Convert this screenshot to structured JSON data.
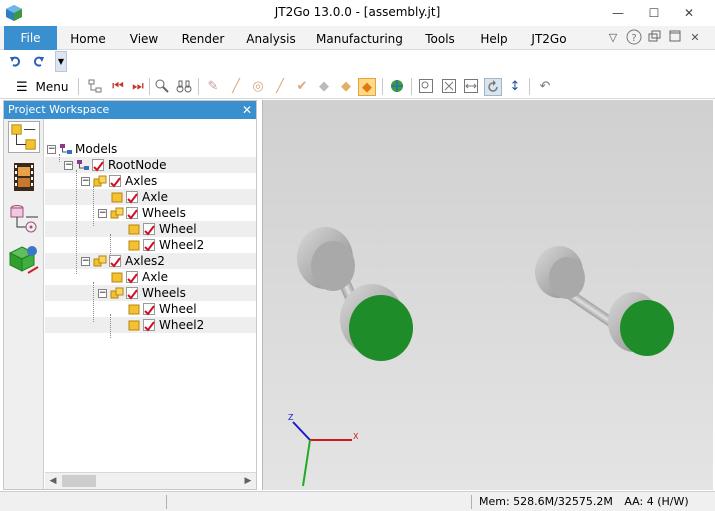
{
  "window": {
    "title": "JT2Go 13.0.0 - [assembly.jt]",
    "minimize_glyph": "—",
    "maximize_glyph": "☐",
    "close_glyph": "✕"
  },
  "menu": {
    "file_label": "File",
    "tabs": [
      "Home",
      "View",
      "Render",
      "Analysis",
      "Manufacturing",
      "Tools",
      "Help",
      "JT2Go"
    ],
    "right_icons": [
      "chevron-down-icon",
      "help-icon",
      "restore-icon",
      "maximize-icon",
      "close-icon"
    ]
  },
  "quick_access": {
    "undo_icon": "undo-icon",
    "redo_icon": "redo-icon"
  },
  "toolbar": {
    "menu_label": "Menu"
  },
  "workspace": {
    "title": "Project Workspace",
    "close_glyph": "✕",
    "side_tabs": [
      "model-tree-icon",
      "film-icon",
      "database-icon",
      "cube-network-icon"
    ]
  },
  "tree": {
    "rows": [
      {
        "label": "Models",
        "icon": "models-icon",
        "checked": false,
        "expander": "−"
      },
      {
        "label": "RootNode",
        "icon": "rootnode-icon",
        "checked": true,
        "expander": "−"
      },
      {
        "label": "Axles",
        "icon": "assembly-icon",
        "checked": true,
        "expander": "−"
      },
      {
        "label": "Axle",
        "icon": "part-icon",
        "checked": true,
        "expander": ""
      },
      {
        "label": "Wheels",
        "icon": "assembly-icon",
        "checked": true,
        "expander": "−"
      },
      {
        "label": "Wheel",
        "icon": "part-icon",
        "checked": true,
        "expander": ""
      },
      {
        "label": "Wheel2",
        "icon": "part-icon",
        "checked": true,
        "expander": ""
      },
      {
        "label": "Axles2",
        "icon": "assembly-icon",
        "checked": true,
        "expander": "−"
      },
      {
        "label": "Axle",
        "icon": "part-icon",
        "checked": true,
        "expander": ""
      },
      {
        "label": "Wheels",
        "icon": "assembly-icon",
        "checked": true,
        "expander": "−"
      },
      {
        "label": "Wheel",
        "icon": "part-icon",
        "checked": true,
        "expander": ""
      },
      {
        "label": "Wheel2",
        "icon": "part-icon",
        "checked": true,
        "expander": ""
      }
    ]
  },
  "viewport": {
    "triad": {
      "x": "X",
      "y": "Y",
      "z": "Z"
    },
    "colors": {
      "wheel_face": "#1f8c2a",
      "wheel_body": "#a8a8a8"
    }
  },
  "status": {
    "memory": "Mem: 528.6M/32575.2M",
    "aa": "AA: 4 (H/W)"
  }
}
